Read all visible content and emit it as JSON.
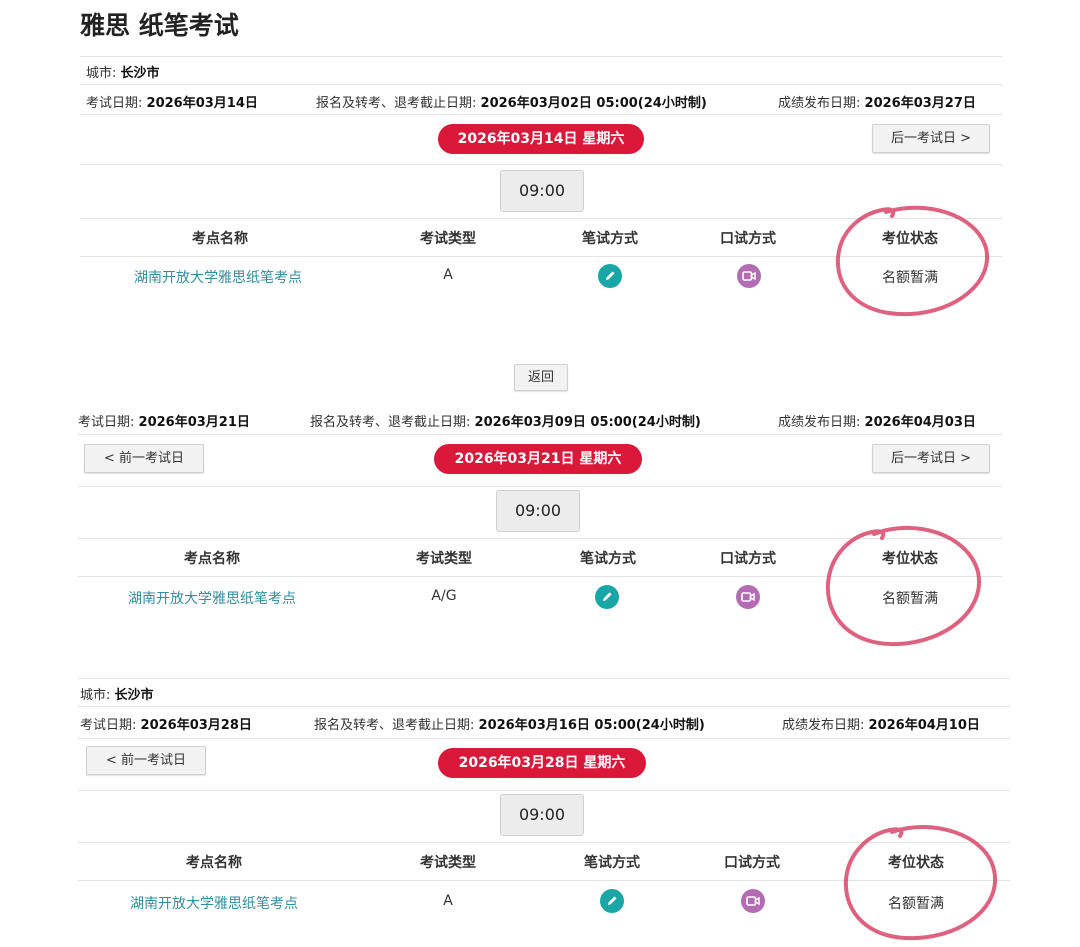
{
  "page_title": "雅思 纸笔考试",
  "labels": {
    "city": "城市:",
    "exam_date": "考试日期:",
    "deadline": "报名及转考、退考截止日期:",
    "result_date": "成绩发布日期:",
    "prev": "< 前一考试日",
    "next": "后一考试日 >",
    "back": "返回",
    "col_venue": "考点名称",
    "col_type": "考试类型",
    "col_written": "笔试方式",
    "col_speaking": "口试方式",
    "col_status": "考位状态"
  },
  "colors": {
    "date_pill": "#d9183a",
    "venue_link": "#2f8ea0",
    "written_icon": "#1aa6a6",
    "speaking_icon": "#b36bb3",
    "circle_mark": "#d9456a"
  },
  "icons": {
    "written": "pencil-icon",
    "speaking": "video-camera-icon"
  },
  "sessions": [
    {
      "city": "长沙市",
      "exam_date": "2026年03月14日",
      "deadline": "2026年03月02日 05:00(24小时制)",
      "result_date": "2026年03月27日",
      "day_label": "2026年03月14日 星期六",
      "time": "09:00",
      "venue": "湖南开放大学雅思纸笔考点",
      "type": "A",
      "status": "名额暂满"
    },
    {
      "exam_date": "2026年03月21日",
      "deadline": "2026年03月09日 05:00(24小时制)",
      "result_date": "2026年04月03日",
      "day_label": "2026年03月21日 星期六",
      "time": "09:00",
      "venue": "湖南开放大学雅思纸笔考点",
      "type": "A/G",
      "status": "名额暂满"
    },
    {
      "city": "长沙市",
      "exam_date": "2026年03月28日",
      "deadline": "2026年03月16日 05:00(24小时制)",
      "result_date": "2026年04月10日",
      "day_label": "2026年03月28日 星期六",
      "time": "09:00",
      "venue": "湖南开放大学雅思纸笔考点",
      "type": "A",
      "status": "名额暂满"
    }
  ]
}
